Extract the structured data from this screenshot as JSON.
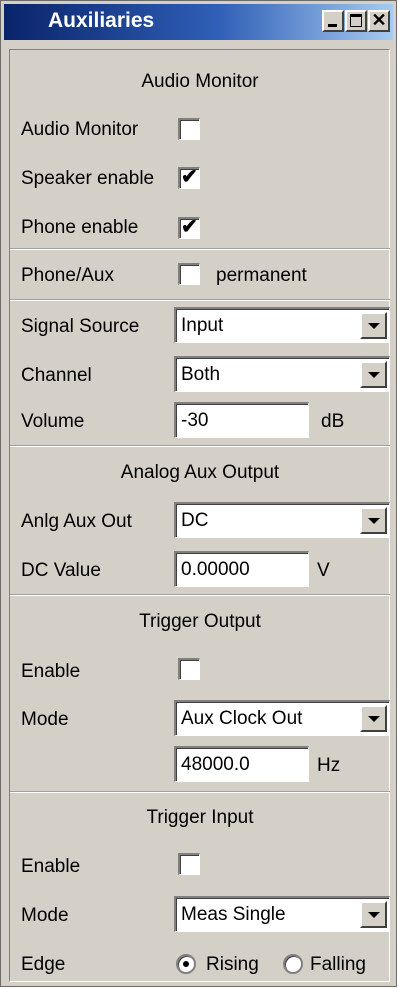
{
  "window": {
    "title": "Auxiliaries"
  },
  "audio_monitor": {
    "header": "Audio Monitor",
    "audio_monitor_label": "Audio Monitor",
    "audio_monitor_checked": false,
    "speaker_enable_label": "Speaker enable",
    "speaker_enable_checked": true,
    "phone_enable_label": "Phone enable",
    "phone_enable_checked": true
  },
  "phone_aux": {
    "label": "Phone/Aux",
    "permanent_label": "permanent",
    "permanent_checked": false
  },
  "signal": {
    "source_label": "Signal Source",
    "source_value": "Input",
    "channel_label": "Channel",
    "channel_value": "Both",
    "volume_label": "Volume",
    "volume_value": "-30",
    "volume_unit": "dB"
  },
  "analog_aux": {
    "header": "Analog Aux Output",
    "out_label": "Anlg Aux Out",
    "out_value": "DC",
    "dc_label": "DC Value",
    "dc_value": "0.00000",
    "dc_unit": "V"
  },
  "trigger_output": {
    "header": "Trigger Output",
    "enable_label": "Enable",
    "enable_checked": false,
    "mode_label": "Mode",
    "mode_value": "Aux Clock Out",
    "freq_value": "48000.0",
    "freq_unit": "Hz"
  },
  "trigger_input": {
    "header": "Trigger Input",
    "enable_label": "Enable",
    "enable_checked": false,
    "mode_label": "Mode",
    "mode_value": "Meas Single",
    "edge_label": "Edge",
    "edge_options": [
      "Rising",
      "Falling"
    ],
    "edge_selected": "Rising"
  },
  "icons": {
    "check_mark": "✔",
    "close_glyph": "✕"
  }
}
